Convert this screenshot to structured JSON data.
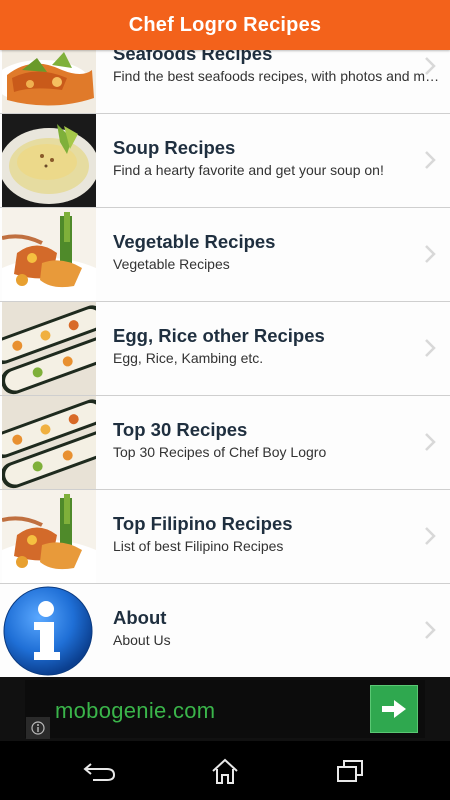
{
  "app": {
    "title": "Chef Logro Recipes",
    "accent_color": "#f3621b"
  },
  "list": {
    "items": [
      {
        "title": "Seafoods Recipes",
        "subtitle": "Find the best seafoods recipes, with photos and more!",
        "image": "seafood-dish-image"
      },
      {
        "title": "Soup Recipes",
        "subtitle": "Find a hearty favorite and get your soup on!",
        "image": "soup-bowl-image"
      },
      {
        "title": "Vegetable Recipes",
        "subtitle": "Vegetable Recipes",
        "image": "vegetable-plate-image"
      },
      {
        "title": "Egg, Rice other Recipes",
        "subtitle": "Egg, Rice, Kambing etc.",
        "image": "sushi-rolls-image"
      },
      {
        "title": "Top 30 Recipes",
        "subtitle": "Top 30 Recipes of Chef Boy Logro",
        "image": "sushi-rolls-image"
      },
      {
        "title": "Top Filipino Recipes",
        "subtitle": "List of best Filipino Recipes",
        "image": "vegetable-plate-image"
      },
      {
        "title": "About",
        "subtitle": "About Us",
        "image": "info-icon"
      }
    ]
  },
  "ad": {
    "text": "mobogenie.com",
    "text_color": "#3ab54a",
    "button_icon": "arrow-right-icon",
    "info_icon": "info-circle-icon"
  },
  "nav": {
    "icons": [
      "back-icon",
      "home-icon",
      "recent-apps-icon"
    ]
  }
}
